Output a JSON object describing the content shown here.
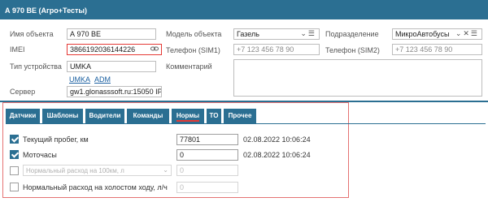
{
  "window": {
    "title": "А 970 ВЕ (Агро+Тесты)"
  },
  "form": {
    "name_label": "Имя объекта",
    "name_value": "А 970 ВЕ",
    "imei_label": "IMEI",
    "imei_value": "3866192036144226",
    "device_type_label": "Тип устройства",
    "device_type_value": "UMKA",
    "links": [
      "UMKA",
      "ADM"
    ],
    "server_label": "Сервер",
    "server_value": "gw1.glonasssoft.ru:15050 IP",
    "model_label": "Модель объекта",
    "model_value": "Газель",
    "phone1_label": "Телефон (SIM1)",
    "phone1_placeholder": "+7 123 456 78 90",
    "comment_label": "Комментарий",
    "division_label": "Подразделение",
    "division_value": "МикроАвтобусы",
    "phone2_label": "Телефон (SIM2)",
    "phone2_placeholder": "+7 123 456 78 90"
  },
  "tabs": [
    "Датчики",
    "Шаблоны",
    "Водители",
    "Команды",
    "Нормы",
    "ТО",
    "Прочее"
  ],
  "active_tab": "Нормы",
  "norms": [
    {
      "label": "Текущий пробег, км",
      "checked": true,
      "value": "77801",
      "timestamp": "02.08.2022 10:06:24"
    },
    {
      "label": "Моточасы",
      "checked": true,
      "value": "0",
      "timestamp": "02.08.2022 10:06:24"
    },
    {
      "label": "Нормальный расход на 100км, л",
      "checked": false,
      "value": "0"
    },
    {
      "label": "Нормальный расход на холостом ходу, л/ч",
      "checked": false,
      "value": "0"
    }
  ],
  "colors": {
    "header": "#2b6f92",
    "highlight": "#e53935"
  },
  "icons": {
    "link": "link-icon",
    "close": "close-icon",
    "menu": "menu-icon",
    "chevron": "chevron-down-icon"
  }
}
